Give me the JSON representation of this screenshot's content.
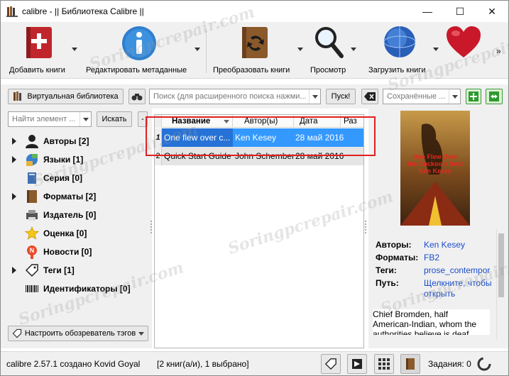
{
  "window": {
    "title": "calibre - || Библиотека Calibre ||"
  },
  "window_controls": {
    "minimize": "—",
    "maximize": "☐",
    "close": "✕"
  },
  "toolbar": {
    "items": [
      {
        "label": "Добавить книги",
        "icon": "add-book-icon"
      },
      {
        "label": "Редактировать метаданные",
        "icon": "info-icon"
      },
      {
        "label": "Преобразовать книги",
        "icon": "convert-book-icon"
      },
      {
        "label": "Просмотр",
        "icon": "magnifier-icon"
      },
      {
        "label": "Загрузить книги",
        "icon": "globe-icon"
      },
      {
        "label": "",
        "icon": "heart-icon"
      }
    ],
    "more": "»"
  },
  "search_row": {
    "virtual_library": "Виртуальная библиотека",
    "search_placeholder": "Поиск (для расширенного поиска нажми...",
    "search_button": "Пуск!",
    "saved_searches": "Сохранённые ..."
  },
  "tag_browser": {
    "find_placeholder": "Найти элемент ...",
    "find_button": "Искать",
    "minus_button": "-",
    "items": [
      {
        "label": "Авторы [2]",
        "expandable": true,
        "icon": "user-icon"
      },
      {
        "label": "Языки [1]",
        "expandable": true,
        "icon": "languages-icon"
      },
      {
        "label": "Серия [0]",
        "expandable": false,
        "icon": "series-icon"
      },
      {
        "label": "Форматы [2]",
        "expandable": true,
        "icon": "book-icon"
      },
      {
        "label": "Издатель [0]",
        "expandable": false,
        "icon": "publisher-icon"
      },
      {
        "label": "Оценка [0]",
        "expandable": false,
        "icon": "star-icon"
      },
      {
        "label": "Новости [0]",
        "expandable": false,
        "icon": "news-icon"
      },
      {
        "label": "Теги [1]",
        "expandable": true,
        "icon": "tag-icon"
      },
      {
        "label": "Идентификаторы [0]",
        "expandable": false,
        "icon": "barcode-icon"
      }
    ],
    "configure_button": "Настроить обозреватель тэгов"
  },
  "book_list": {
    "columns": [
      "Название",
      "Автор(ы)",
      "Дата",
      "Раз"
    ],
    "rows": [
      {
        "num": "1",
        "title": "One flew over c...",
        "author": "Ken Kesey",
        "date": "28 май 2016",
        "selected": true
      },
      {
        "num": "2",
        "title": "Quick Start Guide",
        "author": "John Schember",
        "date": "28 май 2016",
        "selected": false
      }
    ]
  },
  "book_details": {
    "cover_lines": [
      "One Flew Over",
      "the Cuckoo's Nest",
      "Ken Kesey"
    ],
    "fields": [
      {
        "key": "Авторы:",
        "value": "Ken Kesey"
      },
      {
        "key": "Форматы:",
        "value": "FB2"
      },
      {
        "key": "Теги:",
        "value": "prose_contempor"
      },
      {
        "key": "Путь:",
        "value": "Щелкните, чтобы",
        "value2": "открыть"
      }
    ],
    "description": [
      "Chief Bromden, half",
      "American-Indian, whom the",
      "authorities believe is deaf"
    ]
  },
  "statusbar": {
    "text": "calibre 2.57.1 создано Kovid Goyal",
    "count": "[2 книг(а/и), 1 выбрано]",
    "jobs": "Задания: 0"
  },
  "watermark": "Soringpcrepair.com",
  "colors": {
    "selection": "#3399ff",
    "highlight": "#e0201f",
    "link": "#1a4dc8"
  }
}
